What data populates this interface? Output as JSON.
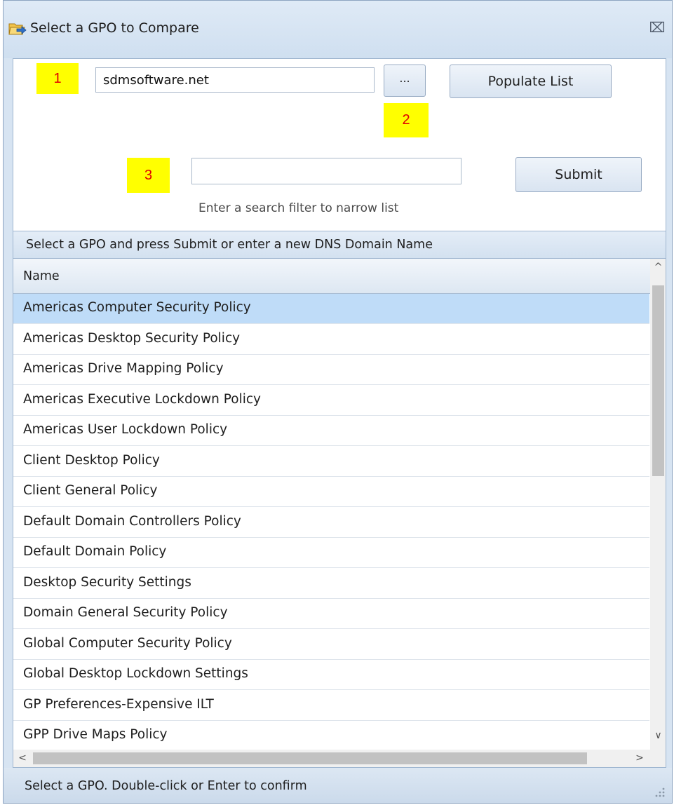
{
  "window": {
    "title": "Select a GPO to Compare",
    "close_glyph": "⌧",
    "title_icon": "folder-arrow-icon"
  },
  "domain": {
    "value": "sdmsoftware.net",
    "browse_label": "...",
    "populate_label": "Populate List"
  },
  "search": {
    "value": "",
    "submit_label": "Submit",
    "hint": "Enter a search filter to narrow list"
  },
  "badges": [
    "1",
    "2",
    "3"
  ],
  "caption": "Select a GPO and press Submit or enter a new DNS Domain Name",
  "grid": {
    "column_header": "Name",
    "rows": [
      "Americas Computer Security Policy",
      "Americas Desktop Security Policy",
      "Americas Drive Mapping Policy",
      "Americas Executive Lockdown Policy",
      "Americas User Lockdown Policy",
      "Client Desktop Policy",
      "Client General Policy",
      "Default Domain Controllers Policy",
      "Default Domain Policy",
      "Desktop Security Settings",
      "Domain General Security Policy",
      "Global Computer Security Policy",
      "Global Desktop Lockdown Settings",
      "GP Preferences-Expensive ILT",
      "GPP Drive Maps Policy"
    ],
    "selected_index": 0
  },
  "scroll": {
    "up": "^",
    "down": "∨",
    "left": "<",
    "right": ">"
  },
  "status": "Select a GPO. Double-click or Enter to confirm",
  "colors": {
    "selection": "#bfdcf8",
    "badge_bg": "#ffff00",
    "badge_text": "#e00000",
    "chrome": "#d7e4f2"
  }
}
